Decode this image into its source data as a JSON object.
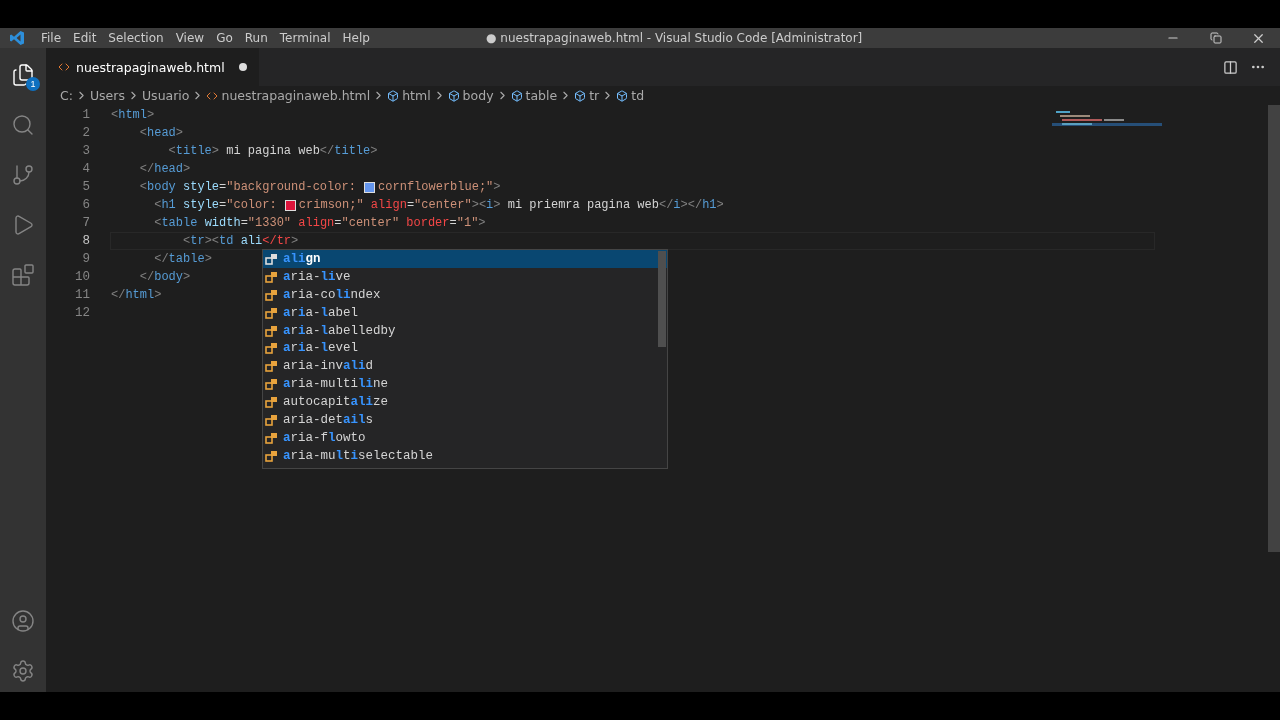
{
  "title_bar": {
    "menu": [
      "File",
      "Edit",
      "Selection",
      "View",
      "Go",
      "Run",
      "Terminal",
      "Help"
    ],
    "title": "● nuestrapaginaweb.html - Visual Studio Code [Administrator]"
  },
  "activity_bar": {
    "explorer_badge": "1"
  },
  "tabs": [
    {
      "label": "nuestrapaginaweb.html",
      "selected": true,
      "modified": true
    }
  ],
  "breadcrumbs": [
    {
      "kind": "folder",
      "label": "C:"
    },
    {
      "kind": "folder",
      "label": "Users"
    },
    {
      "kind": "folder",
      "label": "Usuario"
    },
    {
      "kind": "file",
      "label": "nuestrapaginaweb.html"
    },
    {
      "kind": "element",
      "label": "html"
    },
    {
      "kind": "element",
      "label": "body"
    },
    {
      "kind": "element",
      "label": "table"
    },
    {
      "kind": "element",
      "label": "tr"
    },
    {
      "kind": "element",
      "label": "td"
    }
  ],
  "editor": {
    "lines": [
      {
        "number": "1",
        "active": false,
        "tokens": [
          {
            "kind": "punct",
            "text": "<"
          },
          {
            "kind": "tag",
            "text": "html"
          },
          {
            "kind": "punct",
            "text": ">"
          }
        ]
      },
      {
        "number": "2",
        "active": false,
        "tokens": [
          {
            "kind": "punct",
            "text": "    <"
          },
          {
            "kind": "tag",
            "text": "head"
          },
          {
            "kind": "punct",
            "text": ">"
          }
        ]
      },
      {
        "number": "3",
        "active": false,
        "tokens": [
          {
            "kind": "punct",
            "text": "        <"
          },
          {
            "kind": "tag",
            "text": "title"
          },
          {
            "kind": "punct",
            "text": ">"
          },
          {
            "kind": "text",
            "text": " mi pagina web"
          },
          {
            "kind": "punct",
            "text": "</"
          },
          {
            "kind": "tag",
            "text": "title"
          },
          {
            "kind": "punct",
            "text": ">"
          }
        ]
      },
      {
        "number": "4",
        "active": false,
        "tokens": [
          {
            "kind": "punct",
            "text": "    </"
          },
          {
            "kind": "tag",
            "text": "head"
          },
          {
            "kind": "punct",
            "text": ">"
          }
        ]
      },
      {
        "number": "5",
        "active": false,
        "tokens": [
          {
            "kind": "punct",
            "text": "    <"
          },
          {
            "kind": "tag",
            "text": "body"
          },
          {
            "kind": "attr",
            "text": " style"
          },
          {
            "kind": "text",
            "text": "="
          },
          {
            "kind": "string",
            "text": "\"background-color: "
          },
          {
            "kind": "swatch",
            "color": "#6495ed"
          },
          {
            "kind": "string",
            "text": "cornflowerblue;\""
          },
          {
            "kind": "punct",
            "text": ">"
          }
        ]
      },
      {
        "number": "6",
        "active": false,
        "tokens": [
          {
            "kind": "punct",
            "text": "      <"
          },
          {
            "kind": "tag",
            "text": "h1"
          },
          {
            "kind": "attr",
            "text": " style"
          },
          {
            "kind": "text",
            "text": "="
          },
          {
            "kind": "string",
            "text": "\"color: "
          },
          {
            "kind": "swatch",
            "color": "#dc143c"
          },
          {
            "kind": "string",
            "text": "crimson;\""
          },
          {
            "kind": "error",
            "text": " align"
          },
          {
            "kind": "text",
            "text": "="
          },
          {
            "kind": "string",
            "text": "\"center\""
          },
          {
            "kind": "punct",
            "text": "><"
          },
          {
            "kind": "tag",
            "text": "i"
          },
          {
            "kind": "punct",
            "text": ">"
          },
          {
            "kind": "text",
            "text": " mi priemra pagina web"
          },
          {
            "kind": "punct",
            "text": "</"
          },
          {
            "kind": "tag",
            "text": "i"
          },
          {
            "kind": "punct",
            "text": "></"
          },
          {
            "kind": "tag",
            "text": "h1"
          },
          {
            "kind": "punct",
            "text": ">"
          }
        ]
      },
      {
        "number": "7",
        "active": false,
        "tokens": [
          {
            "kind": "punct",
            "text": "      <"
          },
          {
            "kind": "tag",
            "text": "table"
          },
          {
            "kind": "attr",
            "text": " width"
          },
          {
            "kind": "text",
            "text": "="
          },
          {
            "kind": "string",
            "text": "\"1330\""
          },
          {
            "kind": "error",
            "text": " align"
          },
          {
            "kind": "text",
            "text": "="
          },
          {
            "kind": "string",
            "text": "\"center\""
          },
          {
            "kind": "error",
            "text": " border"
          },
          {
            "kind": "text",
            "text": "="
          },
          {
            "kind": "string",
            "text": "\"1\""
          },
          {
            "kind": "punct",
            "text": ">"
          }
        ]
      },
      {
        "number": "8",
        "active": true,
        "tokens": [
          {
            "kind": "punct",
            "text": "          <"
          },
          {
            "kind": "tag",
            "text": "tr"
          },
          {
            "kind": "punct",
            "text": "><"
          },
          {
            "kind": "tag",
            "text": "td"
          },
          {
            "kind": "attr",
            "text": " ali"
          },
          {
            "kind": "error",
            "text": "</tr"
          },
          {
            "kind": "punct",
            "text": ">"
          }
        ]
      },
      {
        "number": "9",
        "active": false,
        "tokens": [
          {
            "kind": "punct",
            "text": "      </"
          },
          {
            "kind": "tag",
            "text": "table"
          },
          {
            "kind": "punct",
            "text": ">"
          }
        ]
      },
      {
        "number": "10",
        "active": false,
        "tokens": [
          {
            "kind": "punct",
            "text": "    </"
          },
          {
            "kind": "tag",
            "text": "body"
          },
          {
            "kind": "punct",
            "text": ">"
          }
        ]
      },
      {
        "number": "11",
        "active": false,
        "tokens": [
          {
            "kind": "punct",
            "text": "</"
          },
          {
            "kind": "tag",
            "text": "html"
          },
          {
            "kind": "punct",
            "text": ">"
          }
        ]
      },
      {
        "number": "12",
        "active": false
      }
    ]
  },
  "suggestions": [
    {
      "selected": true,
      "parts": [
        {
          "text": "ali",
          "match": true
        },
        {
          "text": "gn",
          "match": false
        }
      ]
    },
    {
      "selected": false,
      "parts": [
        {
          "text": "a",
          "match": true
        },
        {
          "text": "ria-",
          "match": false
        },
        {
          "text": "li",
          "match": true
        },
        {
          "text": "ve",
          "match": false
        }
      ]
    },
    {
      "selected": false,
      "parts": [
        {
          "text": "a",
          "match": true
        },
        {
          "text": "ria-co",
          "match": false
        },
        {
          "text": "li",
          "match": true
        },
        {
          "text": "ndex",
          "match": false
        }
      ]
    },
    {
      "selected": false,
      "parts": [
        {
          "text": "a",
          "match": true
        },
        {
          "text": "r",
          "match": false
        },
        {
          "text": "i",
          "match": true
        },
        {
          "text": "a-",
          "match": false
        },
        {
          "text": "l",
          "match": true
        },
        {
          "text": "abel",
          "match": false
        }
      ]
    },
    {
      "selected": false,
      "parts": [
        {
          "text": "a",
          "match": true
        },
        {
          "text": "r",
          "match": false
        },
        {
          "text": "i",
          "match": true
        },
        {
          "text": "a-",
          "match": false
        },
        {
          "text": "l",
          "match": true
        },
        {
          "text": "abelledby",
          "match": false
        }
      ]
    },
    {
      "selected": false,
      "parts": [
        {
          "text": "a",
          "match": true
        },
        {
          "text": "r",
          "match": false
        },
        {
          "text": "i",
          "match": true
        },
        {
          "text": "a-",
          "match": false
        },
        {
          "text": "l",
          "match": true
        },
        {
          "text": "evel",
          "match": false
        }
      ]
    },
    {
      "selected": false,
      "parts": [
        {
          "text": "aria-inv",
          "match": false
        },
        {
          "text": "ali",
          "match": true
        },
        {
          "text": "d",
          "match": false
        }
      ]
    },
    {
      "selected": false,
      "parts": [
        {
          "text": "a",
          "match": true
        },
        {
          "text": "ria-multi",
          "match": false
        },
        {
          "text": "li",
          "match": true
        },
        {
          "text": "ne",
          "match": false
        }
      ]
    },
    {
      "selected": false,
      "parts": [
        {
          "text": "autocapit",
          "match": false
        },
        {
          "text": "ali",
          "match": true
        },
        {
          "text": "ze",
          "match": false
        }
      ]
    },
    {
      "selected": false,
      "parts": [
        {
          "text": "aria-det",
          "match": false
        },
        {
          "text": "ail",
          "match": true
        },
        {
          "text": "s",
          "match": false
        }
      ]
    },
    {
      "selected": false,
      "parts": [
        {
          "text": "a",
          "match": true
        },
        {
          "text": "ria-f",
          "match": false
        },
        {
          "text": "l",
          "match": true
        },
        {
          "text": "owto",
          "match": false
        }
      ]
    },
    {
      "selected": false,
      "parts": [
        {
          "text": "a",
          "match": true
        },
        {
          "text": "ria-mu",
          "match": false
        },
        {
          "text": "l",
          "match": true
        },
        {
          "text": "t",
          "match": false
        },
        {
          "text": "i",
          "match": true
        },
        {
          "text": "selectable",
          "match": false
        }
      ]
    }
  ]
}
